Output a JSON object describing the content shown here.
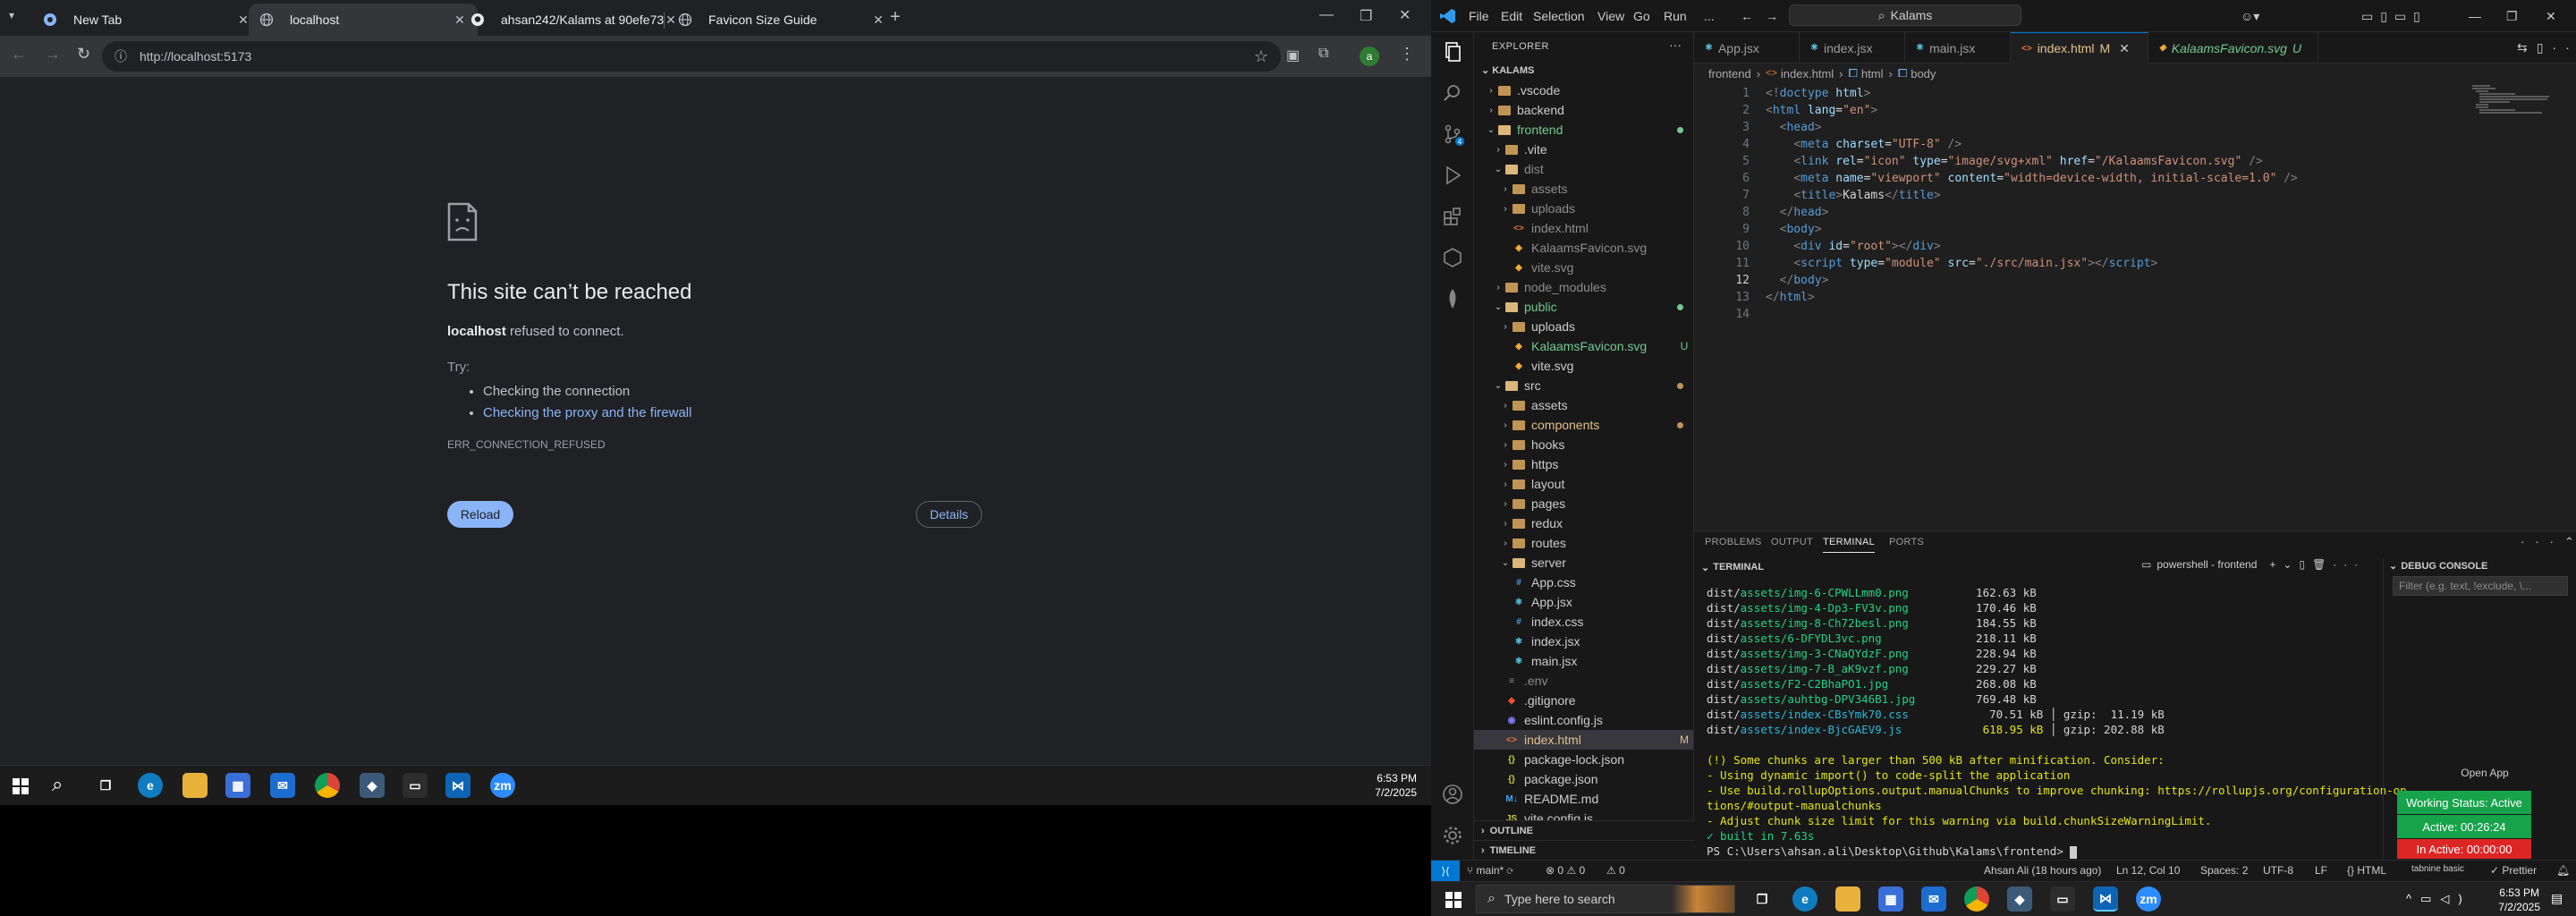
{
  "browser": {
    "tabs": [
      {
        "title": "New Tab",
        "active": false
      },
      {
        "title": "localhost",
        "active": true
      },
      {
        "title": "ahsan242/Kalams at 90efe73bf...",
        "active": false
      },
      {
        "title": "Favicon Size Guide",
        "active": false
      }
    ],
    "url": "http://localhost:5173",
    "error": {
      "title": "This site can’t be reached",
      "host": "localhost",
      "message": " refused to connect.",
      "try_label": "Try:",
      "suggestions": [
        "Checking the connection",
        "Checking the proxy and the firewall"
      ],
      "code": "ERR_CONNECTION_REFUSED",
      "reload_label": "Reload",
      "details_label": "Details"
    },
    "taskbar": {
      "time": "6:53 PM",
      "date": "7/2/2025"
    }
  },
  "vscode": {
    "menu": [
      "File",
      "Edit",
      "Selection",
      "View",
      "Go",
      "Run",
      "..."
    ],
    "search": "Kalams",
    "explorer_title": "EXPLORER",
    "root": "KALAMS",
    "tree": [
      {
        "d": 1,
        "t": "dir",
        "open": false,
        "name": ".vscode"
      },
      {
        "d": 1,
        "t": "dir",
        "open": false,
        "name": "backend"
      },
      {
        "d": 1,
        "t": "dir",
        "open": true,
        "name": "frontend",
        "dot": "#73c991",
        "color": "#73c991"
      },
      {
        "d": 2,
        "t": "dir",
        "open": false,
        "name": ".vite"
      },
      {
        "d": 2,
        "t": "dir",
        "open": true,
        "name": "dist",
        "color": "#8c8c8c"
      },
      {
        "d": 3,
        "t": "dir",
        "open": false,
        "name": "assets",
        "color": "#8c8c8c"
      },
      {
        "d": 3,
        "t": "dir",
        "open": false,
        "name": "uploads",
        "color": "#8c8c8c"
      },
      {
        "d": 3,
        "t": "html",
        "name": "index.html",
        "color": "#8c8c8c"
      },
      {
        "d": 3,
        "t": "svg",
        "name": "KalaamsFavicon.svg",
        "color": "#8c8c8c"
      },
      {
        "d": 3,
        "t": "svg",
        "name": "vite.svg",
        "color": "#8c8c8c"
      },
      {
        "d": 2,
        "t": "dir",
        "open": false,
        "name": "node_modules",
        "color": "#8c8c8c"
      },
      {
        "d": 2,
        "t": "dir",
        "open": true,
        "name": "public",
        "dot": "#73c991",
        "color": "#73c991"
      },
      {
        "d": 3,
        "t": "dir",
        "open": false,
        "name": "uploads"
      },
      {
        "d": 3,
        "t": "svg",
        "name": "KalaamsFavicon.svg",
        "status": "U",
        "color": "#73c991"
      },
      {
        "d": 3,
        "t": "svg",
        "name": "vite.svg"
      },
      {
        "d": 2,
        "t": "dir",
        "open": true,
        "name": "src",
        "dot": "#c09553"
      },
      {
        "d": 3,
        "t": "dir",
        "open": false,
        "name": "assets"
      },
      {
        "d": 3,
        "t": "dir",
        "open": false,
        "name": "components",
        "dot": "#c09553",
        "color": "#e2c08d"
      },
      {
        "d": 3,
        "t": "dir",
        "open": false,
        "name": "hooks"
      },
      {
        "d": 3,
        "t": "dir",
        "open": false,
        "name": "https"
      },
      {
        "d": 3,
        "t": "dir",
        "open": false,
        "name": "layout"
      },
      {
        "d": 3,
        "t": "dir",
        "open": false,
        "name": "pages"
      },
      {
        "d": 3,
        "t": "dir",
        "open": false,
        "name": "redux"
      },
      {
        "d": 3,
        "t": "dir",
        "open": false,
        "name": "routes"
      },
      {
        "d": 3,
        "t": "dir",
        "open": true,
        "name": "server"
      },
      {
        "d": 3,
        "t": "css",
        "name": "App.css"
      },
      {
        "d": 3,
        "t": "jsx",
        "name": "App.jsx"
      },
      {
        "d": 3,
        "t": "css",
        "name": "index.css"
      },
      {
        "d": 3,
        "t": "jsx",
        "name": "index.jsx"
      },
      {
        "d": 3,
        "t": "jsx",
        "name": "main.jsx"
      },
      {
        "d": 2,
        "t": "env",
        "name": ".env",
        "color": "#8c8c8c"
      },
      {
        "d": 2,
        "t": "git",
        "name": ".gitignore"
      },
      {
        "d": 2,
        "t": "eslint",
        "name": "eslint.config.js"
      },
      {
        "d": 2,
        "t": "html",
        "name": "index.html",
        "status": "M",
        "color": "#e2c08d",
        "selected": true
      },
      {
        "d": 2,
        "t": "json",
        "name": "package-lock.json"
      },
      {
        "d": 2,
        "t": "json",
        "name": "package.json"
      },
      {
        "d": 2,
        "t": "md",
        "name": "README.md"
      },
      {
        "d": 2,
        "t": "js",
        "name": "vite.config.js"
      }
    ],
    "outline": "OUTLINE",
    "timeline": "TIMELINE",
    "tabs": [
      {
        "label": "App.jsx",
        "icon": "jsx"
      },
      {
        "label": "index.jsx",
        "icon": "jsx"
      },
      {
        "label": "main.jsx",
        "icon": "jsx"
      },
      {
        "label": "index.html",
        "badge": "M",
        "icon": "html",
        "active": true
      },
      {
        "label": "KalaamsFavicon.svg",
        "badge": "U",
        "icon": "svg",
        "italic": true
      }
    ],
    "breadcrumbs": [
      "frontend",
      "index.html",
      "html",
      "body"
    ],
    "code": [
      [
        [
          "kt",
          "<!"
        ],
        [
          "tg",
          "doctype"
        ],
        [
          "at",
          " html"
        ],
        [
          "kt",
          ">"
        ]
      ],
      [
        [
          "kt",
          "<"
        ],
        [
          "tg",
          "html"
        ],
        [
          "at",
          " lang"
        ],
        [
          "tx",
          "="
        ],
        [
          "sv",
          "\"en\""
        ],
        [
          "kt",
          ">"
        ]
      ],
      [
        [
          "tx",
          "  "
        ],
        [
          "kt",
          "<"
        ],
        [
          "tg",
          "head"
        ],
        [
          "kt",
          ">"
        ]
      ],
      [
        [
          "tx",
          "    "
        ],
        [
          "kt",
          "<"
        ],
        [
          "tg",
          "meta"
        ],
        [
          "at",
          " charset"
        ],
        [
          "tx",
          "="
        ],
        [
          "sv",
          "\"UTF-8\""
        ],
        [
          "kt",
          " />"
        ]
      ],
      [
        [
          "tx",
          "    "
        ],
        [
          "kt",
          "<"
        ],
        [
          "tg",
          "link"
        ],
        [
          "at",
          " rel"
        ],
        [
          "tx",
          "="
        ],
        [
          "sv",
          "\"icon\""
        ],
        [
          "at",
          " type"
        ],
        [
          "tx",
          "="
        ],
        [
          "sv",
          "\"image/svg+xml\""
        ],
        [
          "at",
          " href"
        ],
        [
          "tx",
          "="
        ],
        [
          "sv",
          "\"/KalaamsFavicon.svg\""
        ],
        [
          "kt",
          " />"
        ]
      ],
      [
        [
          "tx",
          "    "
        ],
        [
          "kt",
          "<"
        ],
        [
          "tg",
          "meta"
        ],
        [
          "at",
          " name"
        ],
        [
          "tx",
          "="
        ],
        [
          "sv",
          "\"viewport\""
        ],
        [
          "at",
          " content"
        ],
        [
          "tx",
          "="
        ],
        [
          "sv",
          "\"width=device-width, initial-scale=1.0\""
        ],
        [
          "kt",
          " />"
        ]
      ],
      [
        [
          "tx",
          "    "
        ],
        [
          "kt",
          "<"
        ],
        [
          "tg",
          "title"
        ],
        [
          "kt",
          ">"
        ],
        [
          "tx",
          "Kalams"
        ],
        [
          "kt",
          "</"
        ],
        [
          "tg",
          "title"
        ],
        [
          "kt",
          ">"
        ]
      ],
      [
        [
          "tx",
          "  "
        ],
        [
          "kt",
          "</"
        ],
        [
          "tg",
          "head"
        ],
        [
          "kt",
          ">"
        ]
      ],
      [
        [
          "tx",
          "  "
        ],
        [
          "kt",
          "<"
        ],
        [
          "tg",
          "body"
        ],
        [
          "kt",
          ">"
        ]
      ],
      [
        [
          "tx",
          "    "
        ],
        [
          "kt",
          "<"
        ],
        [
          "tg",
          "div"
        ],
        [
          "at",
          " id"
        ],
        [
          "tx",
          "="
        ],
        [
          "sv",
          "\"root\""
        ],
        [
          "kt",
          "></"
        ],
        [
          "tg",
          "div"
        ],
        [
          "kt",
          ">"
        ]
      ],
      [
        [
          "tx",
          "    "
        ],
        [
          "kt",
          "<"
        ],
        [
          "tg",
          "script"
        ],
        [
          "at",
          " type"
        ],
        [
          "tx",
          "="
        ],
        [
          "sv",
          "\"module\""
        ],
        [
          "at",
          " src"
        ],
        [
          "tx",
          "="
        ],
        [
          "sv",
          "\"./src/main.jsx\""
        ],
        [
          "kt",
          "></"
        ],
        [
          "tg",
          "script"
        ],
        [
          "kt",
          ">"
        ]
      ],
      [
        [
          "tx",
          "  "
        ],
        [
          "kt",
          "</"
        ],
        [
          "tg",
          "body"
        ],
        [
          "kt",
          ">"
        ]
      ],
      [
        [
          "kt",
          "</"
        ],
        [
          "tg",
          "html"
        ],
        [
          "kt",
          ">"
        ]
      ],
      [
        [
          "tx",
          ""
        ]
      ]
    ],
    "current_line": 12,
    "panel_tabs": [
      "PROBLEMS",
      "OUTPUT",
      "TERMINAL",
      "PORTS"
    ],
    "terminal_header": "TERMINAL",
    "terminal_title": "powershell - frontend",
    "debug_console": "DEBUG CONSOLE",
    "debug_filter_placeholder": "Filter (e.g. text, !exclude, \\...",
    "terminal": [
      [
        [
          "tx",
          "dist/"
        ],
        [
          "tg2",
          "assets/img-6-CPWLLmm0.png"
        ],
        [
          "tx",
          "          162.63 kB"
        ]
      ],
      [
        [
          "tx",
          "dist/"
        ],
        [
          "tg2",
          "assets/img-4-Dp3-FV3v.png"
        ],
        [
          "tx",
          "          170.46 kB"
        ]
      ],
      [
        [
          "tx",
          "dist/"
        ],
        [
          "tg2",
          "assets/img-8-Ch72besl.png"
        ],
        [
          "tx",
          "          184.55 kB"
        ]
      ],
      [
        [
          "tx",
          "dist/"
        ],
        [
          "tg2",
          "assets/6-DFYDL3vc.png"
        ],
        [
          "tx",
          "              218.11 kB"
        ]
      ],
      [
        [
          "tx",
          "dist/"
        ],
        [
          "tg2",
          "assets/img-3-CNaQYdzF.png"
        ],
        [
          "tx",
          "          228.94 kB"
        ]
      ],
      [
        [
          "tx",
          "dist/"
        ],
        [
          "tg2",
          "assets/img-7-B_aK9vzf.png"
        ],
        [
          "tx",
          "          229.27 kB"
        ]
      ],
      [
        [
          "tx",
          "dist/"
        ],
        [
          "tg2",
          "assets/F2-C2BhaPO1.jpg"
        ],
        [
          "tx",
          "             268.08 kB"
        ]
      ],
      [
        [
          "tx",
          "dist/"
        ],
        [
          "tg2",
          "assets/auhtbg-DPV346B1.jpg"
        ],
        [
          "tx",
          "         769.48 kB"
        ]
      ],
      [
        [
          "tx",
          "dist/"
        ],
        [
          "tc",
          "assets/index-CBsYmk70.css"
        ],
        [
          "tx",
          "            70.51 kB │ gzip:  11.19 kB"
        ]
      ],
      [
        [
          "tx",
          "dist/"
        ],
        [
          "tc",
          "assets/index-BjcGAEV9.js"
        ],
        [
          "ty",
          "            618.95 kB"
        ],
        [
          "tx",
          " │ gzip: 202.88 kB"
        ]
      ],
      [
        [
          "tx",
          ""
        ]
      ],
      [
        [
          "ty",
          "(!) Some chunks are larger than 500 kB after minification. Consider:"
        ]
      ],
      [
        [
          "ty",
          "- Using dynamic import() to code-split the application"
        ]
      ],
      [
        [
          "ty",
          "- Use build.rollupOptions.output.manualChunks to improve chunking: https://rollupjs.org/configuration-op"
        ]
      ],
      [
        [
          "ty",
          "tions/#output-manualchunks"
        ]
      ],
      [
        [
          "ty",
          "- Adjust chunk size limit for this warning via build.chunkSizeWarningLimit."
        ]
      ],
      [
        [
          "tg2",
          "✓ built in 7.63s"
        ]
      ],
      [
        [
          "tx",
          "PS C:\\Users\\ahsan.ali\\Desktop\\Github\\Kalams\\frontend> "
        ]
      ]
    ],
    "tabnine": {
      "open_app": "Open App",
      "working": "Working Status: Active",
      "active": "Active: 00:26:24",
      "inactive": "In Active: 00:00:00",
      "status": "tabnine basic"
    },
    "statusbar": {
      "branch": "main*",
      "problems": "⊗ 0 ⚠ 0",
      "ports": "⚠ 0",
      "blame": "Ahsan Ali (18 hours ago)",
      "position": "Ln 12, Col 10",
      "spaces": "Spaces: 2",
      "encoding": "UTF-8",
      "eol": "LF",
      "language": "HTML",
      "prettier": "✓ Prettier"
    }
  },
  "taskbar": {
    "search_placeholder": "Type here to search",
    "time": "6:53 PM",
    "date": "7/2/2025"
  },
  "colors": {
    "accent": "#0078d4",
    "chrome_link": "#8ab4f8",
    "tabnine_green": "#16a34a",
    "tabnine_red": "#dc2626"
  }
}
